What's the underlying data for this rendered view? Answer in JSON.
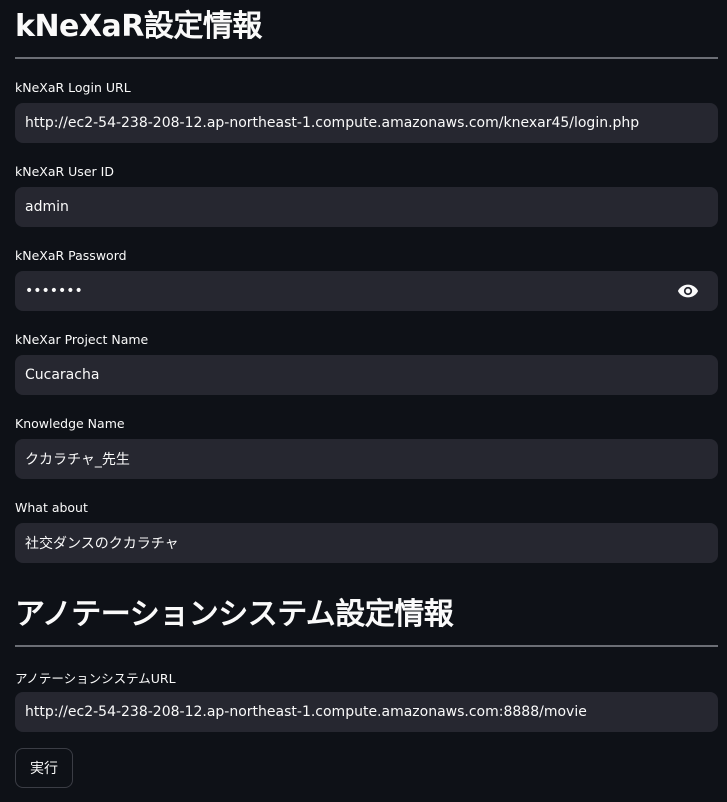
{
  "knexar_section": {
    "title": "kNeXaR設定情報",
    "fields": {
      "login_url": {
        "label": "kNeXaR Login URL",
        "value": "http://ec2-54-238-208-12.ap-northeast-1.compute.amazonaws.com/knexar45/login.php"
      },
      "user_id": {
        "label": "kNeXaR User ID",
        "value": "admin"
      },
      "password": {
        "label": "kNeXaR Password",
        "value": "•••••••"
      },
      "project_name": {
        "label": "kNeXar Project Name",
        "value": "Cucaracha"
      },
      "knowledge_name": {
        "label": "Knowledge Name",
        "value": "クカラチャ_先生"
      },
      "what_about": {
        "label": "What about",
        "value": "社交ダンスのクカラチャ"
      }
    }
  },
  "annotation_section": {
    "title": "アノテーションシステム設定情報",
    "fields": {
      "system_url": {
        "label": "アノテーションシステムURL",
        "value": "http://ec2-54-238-208-12.ap-northeast-1.compute.amazonaws.com:8888/movie"
      }
    }
  },
  "actions": {
    "run_label": "実行"
  },
  "icons": {
    "password_toggle": "eye-icon"
  },
  "colors": {
    "background": "#0e1117",
    "input_background": "#262730",
    "text": "#fafafa",
    "divider": "#6b6e75"
  }
}
